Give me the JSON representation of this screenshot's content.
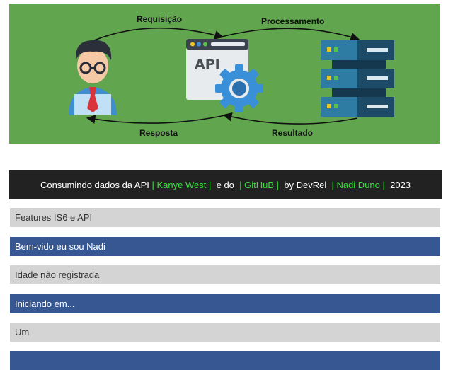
{
  "hero": {
    "label_request": "Requisição",
    "label_processing": "Processamento",
    "label_response": "Resposta",
    "label_result": "Resultado",
    "api_text": "API"
  },
  "footer": {
    "part1": "Consumindo dados da API ",
    "sep1": "| ",
    "link1": "Kanye West",
    "sep2": " | ",
    "part2": " e do ",
    "sep3": " | ",
    "link2": "GitHuB",
    "sep4": " | ",
    "part3": " by DevRel ",
    "sep5": " | ",
    "link3": "Nadi Duno",
    "sep6": " | ",
    "year": " 2023"
  },
  "rows": [
    {
      "text": "Features IS6 e API"
    },
    {
      "text": "Bem-vido eu sou Nadi"
    },
    {
      "text": "Idade não registrada"
    },
    {
      "text": "Iniciando em..."
    },
    {
      "text": "Um"
    },
    {
      "text": ""
    }
  ],
  "colors": {
    "hero_bg": "#61a54f",
    "footer_bg": "#222222",
    "highlight": "#35e23a",
    "row_gray": "#d4d4d4",
    "row_blue": "#365791"
  }
}
